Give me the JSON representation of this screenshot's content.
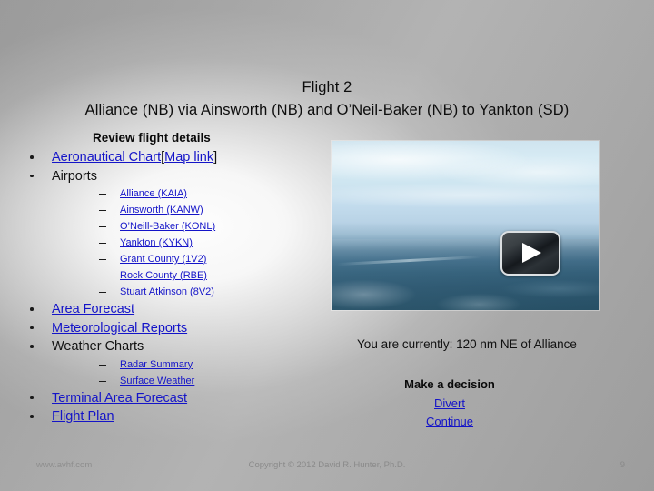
{
  "slide": {
    "title_line1": "Flight 2",
    "title_line2": "Alliance (NB) via Ainsworth (NB) and O’Neil-Baker (NB) to Yankton (SD)",
    "background_color": "#a8a8a8",
    "link_color": "#1414c8",
    "text_color": "#111111"
  },
  "left": {
    "heading": "Review flight details",
    "items": [
      {
        "label": "Aeronautical Chart",
        "link": true
      },
      {
        "label": "Map link",
        "link": true,
        "bracket_open": "[",
        "bracket_close": "]"
      },
      {
        "label": "Airports",
        "link": false
      }
    ],
    "bullet1_aeronautical": "Aeronautical Chart",
    "bullet1_maplink": "Map link",
    "bracket_open": "[",
    "bracket_close": "]",
    "bullet2_airports": "Airports",
    "airports": [
      "Alliance (KAIA)",
      "Ainsworth (KANW)",
      "O’Neill-Baker (KONL)",
      "Yankton (KYKN)",
      "Grant County (1V2)",
      "Rock County (RBE)",
      "Stuart Atkinson (8V2)"
    ],
    "area_forecast": "Area Forecast",
    "met_reports": "Meteorological Reports",
    "weather_charts": "Weather Charts",
    "weather_sub": [
      "Radar Summary",
      "Surface Weather"
    ],
    "terminal_area_forecast": "Terminal Area Forecast",
    "flight_plan": "Flight Plan"
  },
  "video": {
    "icon": "play-icon",
    "description": "Aerial in-flight view of terrain below hazy sky"
  },
  "right": {
    "status": "You are currently: 120 nm NE of Alliance",
    "decision_title": "Make a decision",
    "decision_options": [
      "Divert",
      "Continue"
    ]
  },
  "footer": {
    "site": "www.avhf.com",
    "copyright": "Copyright © 2012 David R. Hunter, Ph.D.",
    "page_number": "9"
  }
}
